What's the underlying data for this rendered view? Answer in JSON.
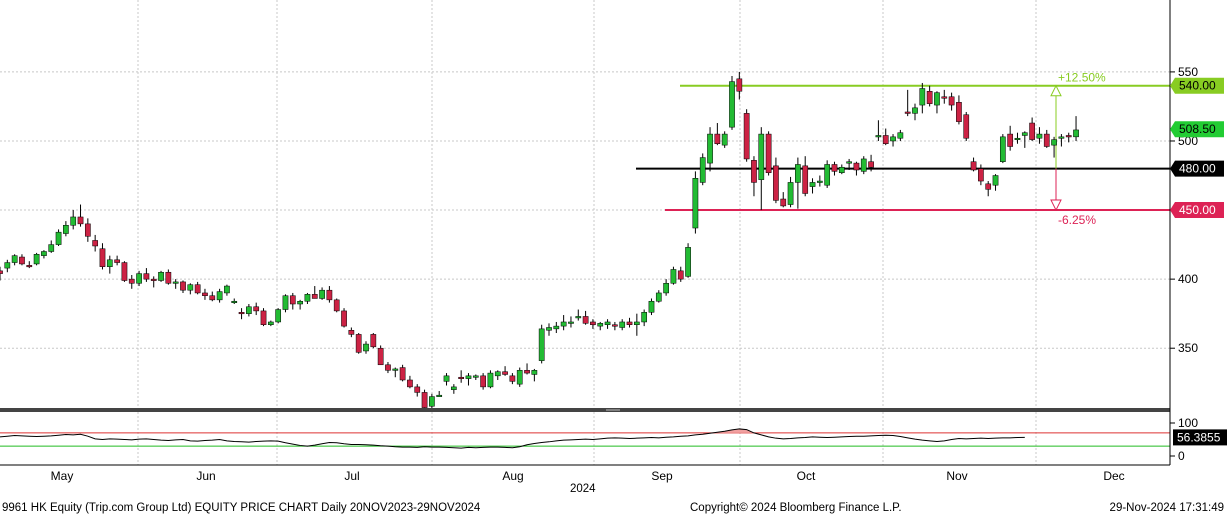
{
  "footer": {
    "left": "9961 HK Equity (Trip.com Group Ltd) EQUITY PRICE CHART  Daily 20NOV2023-29NOV2024",
    "center": "Copyright© 2024 Bloomberg Finance L.P.",
    "right": "29-Nov-2024 17:31:49"
  },
  "year_label": "2024",
  "colors": {
    "up": "#22bb33",
    "down": "#cc2244",
    "upper_line": "#88cc22",
    "lower_line": "#dd2255",
    "mid_line": "#000000",
    "rsi_fill": "#f0a0a0"
  },
  "chart_data": [
    {
      "type": "candlestick",
      "title": "",
      "x_tick_labels": [
        "May",
        "Jun",
        "Jul",
        "Aug",
        "Sep",
        "Oct",
        "Nov",
        "Dec"
      ],
      "y_ticks": [
        350,
        400,
        450,
        500,
        550
      ],
      "ylim": [
        306,
        555
      ],
      "grid": true,
      "price_labels": [
        {
          "label": "540.00",
          "value": 540,
          "style": "upper"
        },
        {
          "label": "508.50",
          "value": 508.5,
          "style": "last"
        },
        {
          "label": "480.00",
          "value": 480,
          "style": "mid"
        },
        {
          "label": "450.00",
          "value": 450,
          "style": "lower"
        }
      ],
      "horizontal_lines": [
        {
          "value": 540,
          "label": "+12.50%"
        },
        {
          "value": 480,
          "label": ""
        },
        {
          "value": 450,
          "label": "-6.25%"
        }
      ],
      "candles_ohlc": [
        [
          406,
          409,
          399,
          404
        ],
        [
          408,
          414,
          405,
          412
        ],
        [
          412,
          418,
          410,
          417
        ],
        [
          416,
          418,
          410,
          411
        ],
        [
          410,
          413,
          408,
          409
        ],
        [
          411,
          419,
          410,
          418
        ],
        [
          417,
          421,
          415,
          420
        ],
        [
          420,
          428,
          419,
          425
        ],
        [
          425,
          436,
          424,
          434
        ],
        [
          433,
          442,
          431,
          439
        ],
        [
          439,
          450,
          436,
          445
        ],
        [
          445,
          454,
          438,
          440
        ],
        [
          440,
          444,
          427,
          431
        ],
        [
          428,
          432,
          420,
          424
        ],
        [
          422,
          426,
          407,
          409
        ],
        [
          409,
          417,
          404,
          414
        ],
        [
          414,
          417,
          410,
          412
        ],
        [
          412,
          413,
          398,
          399
        ],
        [
          400,
          403,
          393,
          397
        ],
        [
          397,
          406,
          395,
          404
        ],
        [
          404,
          408,
          398,
          400
        ],
        [
          400,
          402,
          394,
          399
        ],
        [
          399,
          406,
          398,
          405
        ],
        [
          405,
          407,
          396,
          397
        ],
        [
          397,
          400,
          393,
          398
        ],
        [
          398,
          399,
          390,
          392
        ],
        [
          392,
          397,
          389,
          396
        ],
        [
          396,
          398,
          389,
          390
        ],
        [
          390,
          393,
          385,
          388
        ],
        [
          388,
          391,
          384,
          385
        ],
        [
          385,
          393,
          383,
          391
        ],
        [
          390,
          396,
          388,
          395
        ],
        [
          384,
          386,
          382,
          384
        ],
        [
          376,
          379,
          371,
          375
        ],
        [
          375,
          382,
          373,
          380
        ],
        [
          380,
          383,
          374,
          377
        ],
        [
          377,
          379,
          366,
          367
        ],
        [
          367,
          370,
          366,
          369
        ],
        [
          369,
          379,
          368,
          378
        ],
        [
          378,
          389,
          376,
          388
        ],
        [
          388,
          390,
          378,
          382
        ],
        [
          382,
          385,
          378,
          384
        ],
        [
          384,
          390,
          382,
          389
        ],
        [
          389,
          395,
          386,
          386
        ],
        [
          386,
          394,
          385,
          392
        ],
        [
          392,
          395,
          383,
          385
        ],
        [
          385,
          386,
          376,
          377
        ],
        [
          377,
          379,
          365,
          366
        ],
        [
          363,
          365,
          358,
          360
        ],
        [
          360,
          361,
          346,
          347
        ],
        [
          348,
          355,
          346,
          353
        ],
        [
          360,
          361,
          350,
          351
        ],
        [
          350,
          352,
          338,
          338
        ],
        [
          338,
          340,
          332,
          334
        ],
        [
          334,
          336,
          329,
          335
        ],
        [
          336,
          338,
          326,
          327
        ],
        [
          327,
          330,
          321,
          322
        ],
        [
          322,
          324,
          315,
          318
        ],
        [
          318,
          320,
          306,
          307
        ],
        [
          308,
          317,
          304,
          315
        ],
        [
          316,
          319,
          315,
          316
        ],
        [
          326,
          332,
          323,
          330
        ],
        [
          320,
          324,
          317,
          322
        ],
        [
          329,
          334,
          325,
          328
        ],
        [
          328,
          332,
          323,
          330
        ],
        [
          329,
          331,
          327,
          330
        ],
        [
          330,
          332,
          320,
          322
        ],
        [
          322,
          334,
          321,
          332
        ],
        [
          330,
          334,
          327,
          333
        ],
        [
          333,
          337,
          330,
          331
        ],
        [
          330,
          332,
          324,
          326
        ],
        [
          324,
          336,
          322,
          334
        ],
        [
          334,
          339,
          331,
          332
        ],
        [
          331,
          335,
          326,
          334
        ],
        [
          341,
          367,
          339,
          364
        ],
        [
          363,
          368,
          359,
          365
        ],
        [
          364,
          369,
          361,
          366
        ],
        [
          366,
          374,
          363,
          369
        ],
        [
          368,
          373,
          365,
          369
        ],
        [
          372,
          378,
          370,
          373
        ],
        [
          373,
          377,
          367,
          368
        ],
        [
          369,
          371,
          364,
          367
        ],
        [
          366,
          369,
          363,
          368
        ],
        [
          367,
          371,
          364,
          369
        ],
        [
          367,
          369,
          363,
          366
        ],
        [
          365,
          371,
          363,
          369
        ],
        [
          369,
          372,
          365,
          367
        ],
        [
          367,
          375,
          359,
          369
        ],
        [
          369,
          378,
          366,
          376
        ],
        [
          376,
          386,
          374,
          384
        ],
        [
          384,
          392,
          383,
          390
        ],
        [
          390,
          400,
          388,
          397
        ],
        [
          397,
          409,
          396,
          407
        ],
        [
          406,
          409,
          398,
          400
        ],
        [
          402,
          426,
          401,
          423
        ],
        [
          437,
          478,
          433,
          473
        ],
        [
          470,
          491,
          468,
          488
        ],
        [
          484,
          510,
          478,
          505
        ],
        [
          505,
          513,
          497,
          498
        ],
        [
          497,
          507,
          495,
          505
        ],
        [
          510,
          547,
          508,
          543
        ],
        [
          545,
          550,
          530,
          536
        ],
        [
          520,
          523,
          485,
          487
        ],
        [
          486,
          489,
          460,
          470
        ],
        [
          472,
          510,
          450,
          505
        ],
        [
          505,
          507,
          475,
          477
        ],
        [
          482,
          488,
          455,
          457
        ],
        [
          458,
          463,
          452,
          453
        ],
        [
          454,
          474,
          452,
          470
        ],
        [
          470,
          488,
          451,
          483
        ],
        [
          482,
          489,
          460,
          462
        ],
        [
          467,
          473,
          462,
          470
        ],
        [
          470,
          475,
          467,
          471
        ],
        [
          468,
          486,
          466,
          483
        ],
        [
          483,
          485,
          475,
          478
        ],
        [
          477,
          483,
          476,
          481
        ],
        [
          484,
          487,
          479,
          485
        ],
        [
          484,
          485,
          475,
          479
        ],
        [
          478,
          489,
          476,
          487
        ],
        [
          485,
          490,
          478,
          481
        ],
        [
          504,
          515,
          500,
          504
        ],
        [
          504,
          509,
          497,
          498
        ],
        [
          500,
          505,
          496,
          503
        ],
        [
          502,
          508,
          500,
          506
        ],
        [
          521,
          537,
          518,
          520
        ],
        [
          520,
          527,
          515,
          524
        ],
        [
          526,
          542,
          520,
          538
        ],
        [
          536,
          540,
          525,
          527
        ],
        [
          526,
          536,
          520,
          535
        ],
        [
          532,
          537,
          527,
          531
        ],
        [
          532,
          535,
          522,
          526
        ],
        [
          528,
          533,
          512,
          514
        ],
        [
          519,
          521,
          500,
          502
        ],
        [
          485,
          488,
          478,
          479
        ],
        [
          480,
          483,
          468,
          471
        ],
        [
          469,
          471,
          460,
          465
        ],
        [
          468,
          476,
          464,
          475
        ],
        [
          485,
          505,
          484,
          503
        ],
        [
          505,
          511,
          493,
          496
        ],
        [
          502,
          506,
          498,
          502
        ],
        [
          504,
          507,
          495,
          506
        ],
        [
          513,
          517,
          500,
          501
        ],
        [
          502,
          510,
          498,
          505
        ],
        [
          505,
          508,
          495,
          496
        ],
        [
          497,
          503,
          488,
          501
        ],
        [
          502,
          505,
          496,
          503
        ],
        [
          504,
          506,
          499,
          503
        ],
        [
          503,
          518,
          500,
          508
        ]
      ]
    },
    {
      "type": "line",
      "title": "",
      "series_name": "RSI",
      "y_ticks": [
        0,
        100
      ],
      "ylim": [
        -10,
        115
      ],
      "reference_lines": [
        70,
        30
      ],
      "last_value_label": "56.3855",
      "values": [
        58,
        60,
        62,
        61,
        60,
        59,
        60,
        61,
        63,
        65,
        64,
        66,
        60,
        52,
        50,
        52,
        51,
        50,
        49,
        51,
        52,
        50,
        48,
        47,
        49,
        50,
        46,
        45,
        47,
        48,
        50,
        46,
        44,
        43,
        42,
        44,
        45,
        46,
        45,
        40,
        36,
        32,
        30,
        33,
        37,
        41,
        40,
        37,
        35,
        35,
        34,
        33,
        31,
        30,
        28,
        27,
        27,
        26,
        28,
        27,
        27,
        26,
        25,
        24,
        26,
        25,
        26,
        27,
        27,
        26,
        25,
        28,
        34,
        38,
        41,
        43,
        46,
        48,
        49,
        50,
        51,
        50,
        52,
        54,
        55,
        54,
        53,
        54,
        55,
        56,
        55,
        57,
        58,
        60,
        61,
        64,
        66,
        69,
        72,
        75,
        79,
        82,
        80,
        70,
        64,
        58,
        54,
        52,
        53,
        55,
        56,
        58,
        57,
        56,
        57,
        58,
        59,
        60,
        60,
        61,
        62,
        63,
        62,
        59,
        55,
        51,
        48,
        46,
        44,
        46,
        50,
        53,
        52,
        53,
        54,
        53,
        54,
        55,
        55,
        56,
        56.3855
      ]
    }
  ]
}
